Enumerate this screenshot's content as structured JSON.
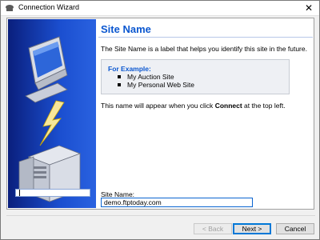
{
  "window": {
    "title": "Connection Wizard",
    "close_glyph": "✕"
  },
  "page": {
    "title": "Site Name",
    "intro": "The Site Name is a label that helps you identify this site in the future.",
    "example_heading": "For Example:",
    "examples": [
      "My Auction Site",
      "My Personal Web Site"
    ],
    "note_prefix": "This name will appear when you click ",
    "note_bold": "Connect",
    "note_suffix": " at the top left."
  },
  "form": {
    "site_name_label": "Site Name:",
    "site_name_value": "demo.ftptoday.com"
  },
  "buttons": {
    "back": "< Back",
    "next": "Next >",
    "cancel": "Cancel"
  },
  "colors": {
    "title_blue": "#0b57d0",
    "panel_blue": "#1b4fd0",
    "focus_border": "#0078d7"
  },
  "icons": {
    "app": "connection-wizard-icon",
    "illustration": "computer-to-server-lightning-icon"
  }
}
